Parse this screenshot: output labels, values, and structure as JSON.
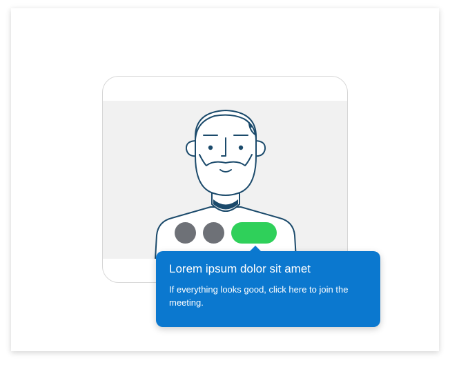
{
  "illustration": {
    "icon": "person-avatar-icon",
    "colors": {
      "line": "#1b4a6b",
      "screen_bg": "#f1f1f1"
    }
  },
  "controls": {
    "buttons": [
      {
        "icon": "circle-control-icon",
        "color": "#6e7177"
      },
      {
        "icon": "circle-control-icon",
        "color": "#6e7177"
      },
      {
        "icon": "join-pill-icon",
        "color": "#2fd05a"
      }
    ]
  },
  "tooltip": {
    "title": "Lorem ipsum dolor sit amet",
    "body": "If everything looks good, click here to join the meeting.",
    "color": "#0b78cf"
  }
}
